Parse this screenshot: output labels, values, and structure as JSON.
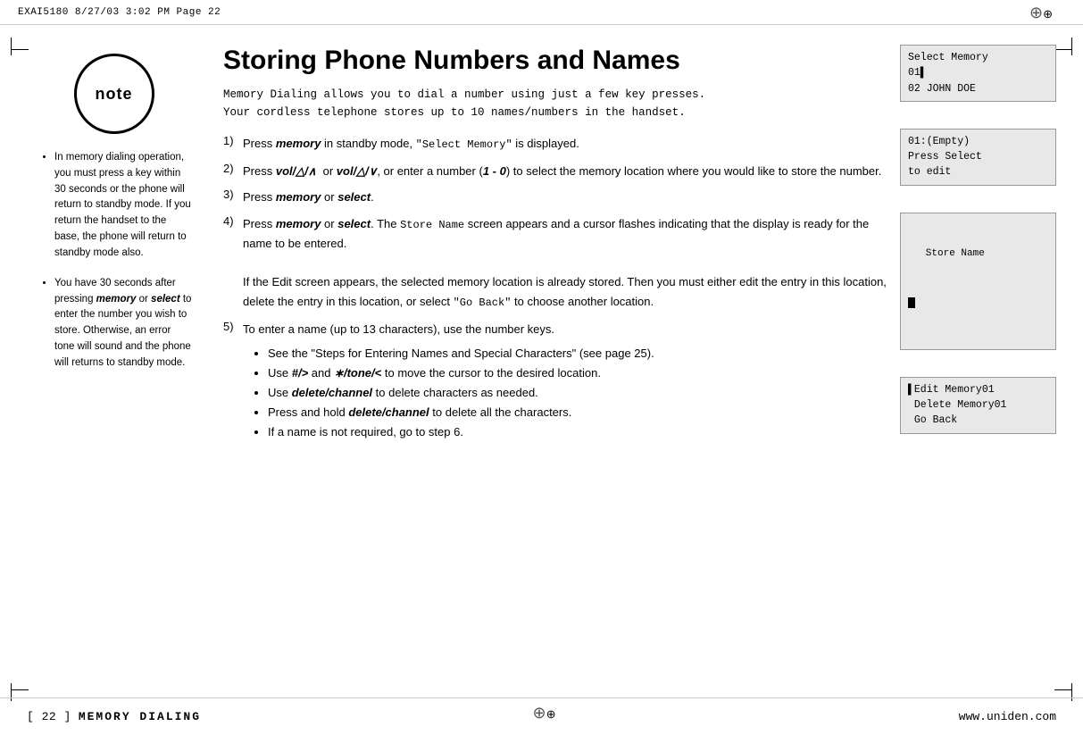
{
  "header": {
    "text": "EXAI5180   8/27/03  3:02 PM   Page 22"
  },
  "note": {
    "label": "note",
    "bullets": [
      "In memory dialing operation, you must press a key within 30 seconds or the phone will return to standby mode. If you return the handset to the base, the phone will return to standby mode also.",
      "You have 30 seconds after pressing memory or select to enter the number you wish to store. Otherwise, an error tone will sound and the phone will returns to standby mode."
    ]
  },
  "title": "Storing Phone Numbers and Names",
  "intro": {
    "line1": "Memory Dialing allows you to dial a number using just a few key presses.",
    "line2": "Your cordless telephone stores up to 10 names/numbers in the handset."
  },
  "steps": {
    "step1": {
      "num": "1)",
      "text_pre": "Press ",
      "bold_italic": "memory",
      "text_mid": " in standby mode, ",
      "mono": "\"Select Memory\"",
      "text_post": " is displayed."
    },
    "step2": {
      "num": "2)",
      "text_pre": "Press ",
      "bold_italic1": "vol/△/∧",
      "text_or": "  or ",
      "bold_italic2": "vol/△/∨",
      "text_post": ", or enter a number (1 - 0) to select the memory location where you would like to store the number."
    },
    "step3": {
      "num": "3)",
      "text_pre": "Press ",
      "bold_italic1": "memory",
      "text_or": " or ",
      "bold_italic2": "select",
      "text_post": "."
    },
    "step4": {
      "num": "4)",
      "text_pre": "Press ",
      "bold_italic1": "memory",
      "text_or": " or ",
      "bold_italic2": "select",
      "text_mid": ". The ",
      "mono": "Store Name",
      "text_post": " screen appears and a cursor flashes indicating that the display is ready for the name to be entered.",
      "sub_text": "If the Edit screen appears, the selected memory location is already stored. Then you must either edit the entry in this location, delete the entry in this location, or select \"Go Back\" to choose another location."
    },
    "step5": {
      "num": "5)",
      "text": "To enter a name (up to 13 characters), use the number keys.",
      "bullets": [
        "See the \"Steps for Entering Names and Special Characters\" (see page 25).",
        "Use #/> and */tone/< to move the cursor to the desired location.",
        "Use delete/channel to delete characters as needed.",
        "Press and hold delete/channel to delete all the characters.",
        "If a name is not required, go to step 6."
      ],
      "bullet_bold": [
        "#/>",
        "*/tone/<",
        "delete/channel",
        "delete/channel"
      ]
    }
  },
  "screens": {
    "screen1": {
      "lines": [
        "Select Memory",
        "01▌",
        "02 JOHN DOE"
      ]
    },
    "screen2": {
      "lines": [
        "01:(Empty)",
        "Press Select",
        "to edit"
      ]
    },
    "screen3": {
      "label": "Store Name",
      "cursor": true
    },
    "screen4": {
      "lines": [
        "▌Edit Memory01",
        " Delete Memory01",
        " Go Back"
      ]
    }
  },
  "footer": {
    "page_bracket": "[ 22 ]",
    "section": "MEMORY DIALING",
    "url": "www.uniden.com"
  }
}
